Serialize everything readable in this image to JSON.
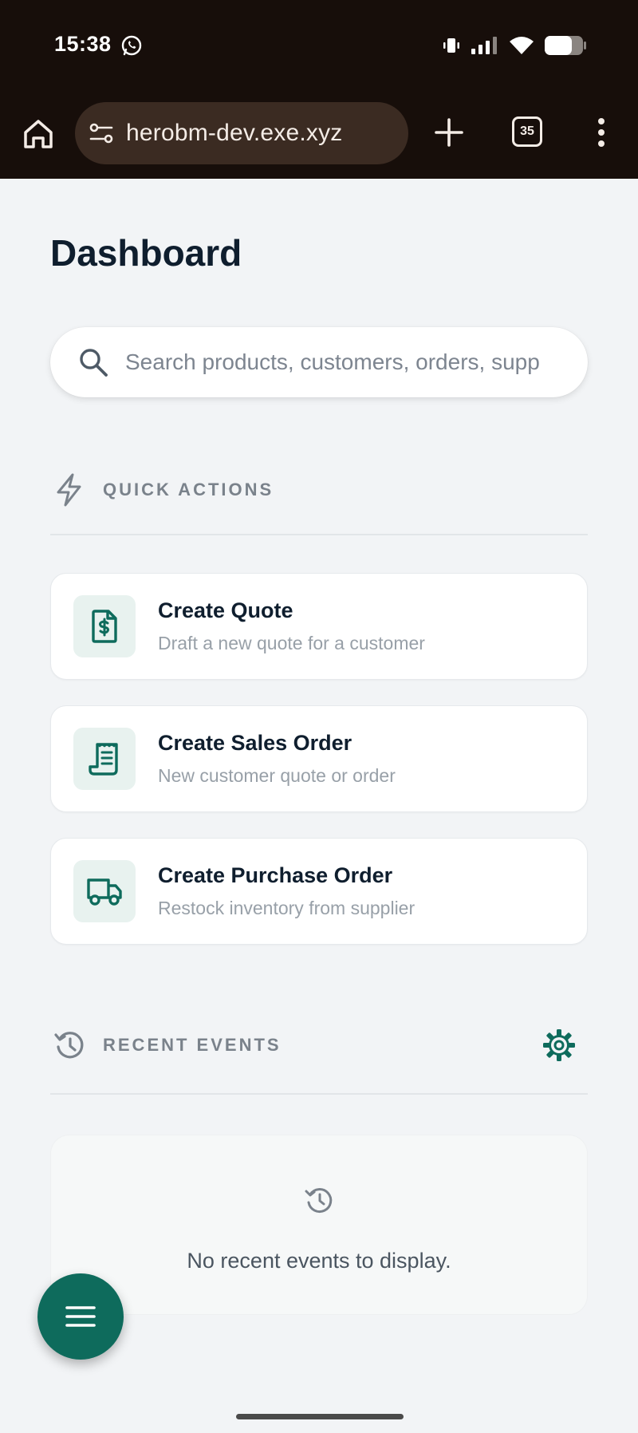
{
  "status_bar": {
    "time": "15:38",
    "icons": [
      "whatsapp-icon",
      "vibrate-icon",
      "signal-icon",
      "wifi-icon",
      "battery-icon"
    ]
  },
  "browser": {
    "url": "herobm-dev.exe.xyz",
    "tab_count": "35",
    "colors": {
      "bar": "#170e0a",
      "pill": "#3b2b22"
    }
  },
  "page": {
    "title": "Dashboard",
    "search_placeholder": "Search products, customers, orders, supp"
  },
  "quick_actions": {
    "label": "QUICK ACTIONS",
    "icon": "lightning-icon",
    "items": [
      {
        "title": "Create Quote",
        "subtitle": "Draft a new quote for a customer",
        "icon": "dollar-document-icon"
      },
      {
        "title": "Create Sales Order",
        "subtitle": "New customer quote or order",
        "icon": "receipt-icon"
      },
      {
        "title": "Create Purchase Order",
        "subtitle": "Restock inventory from supplier",
        "icon": "truck-icon"
      }
    ]
  },
  "recent_events": {
    "label": "RECENT EVENTS",
    "icon": "history-icon",
    "settings_icon": "gear-icon",
    "empty_text": "No recent events to display."
  },
  "fab": {
    "icon": "hamburger-menu-icon"
  },
  "colors": {
    "accent": "#0e6b5c",
    "accent_light": "#e8f2ef",
    "background": "#f2f4f6"
  }
}
